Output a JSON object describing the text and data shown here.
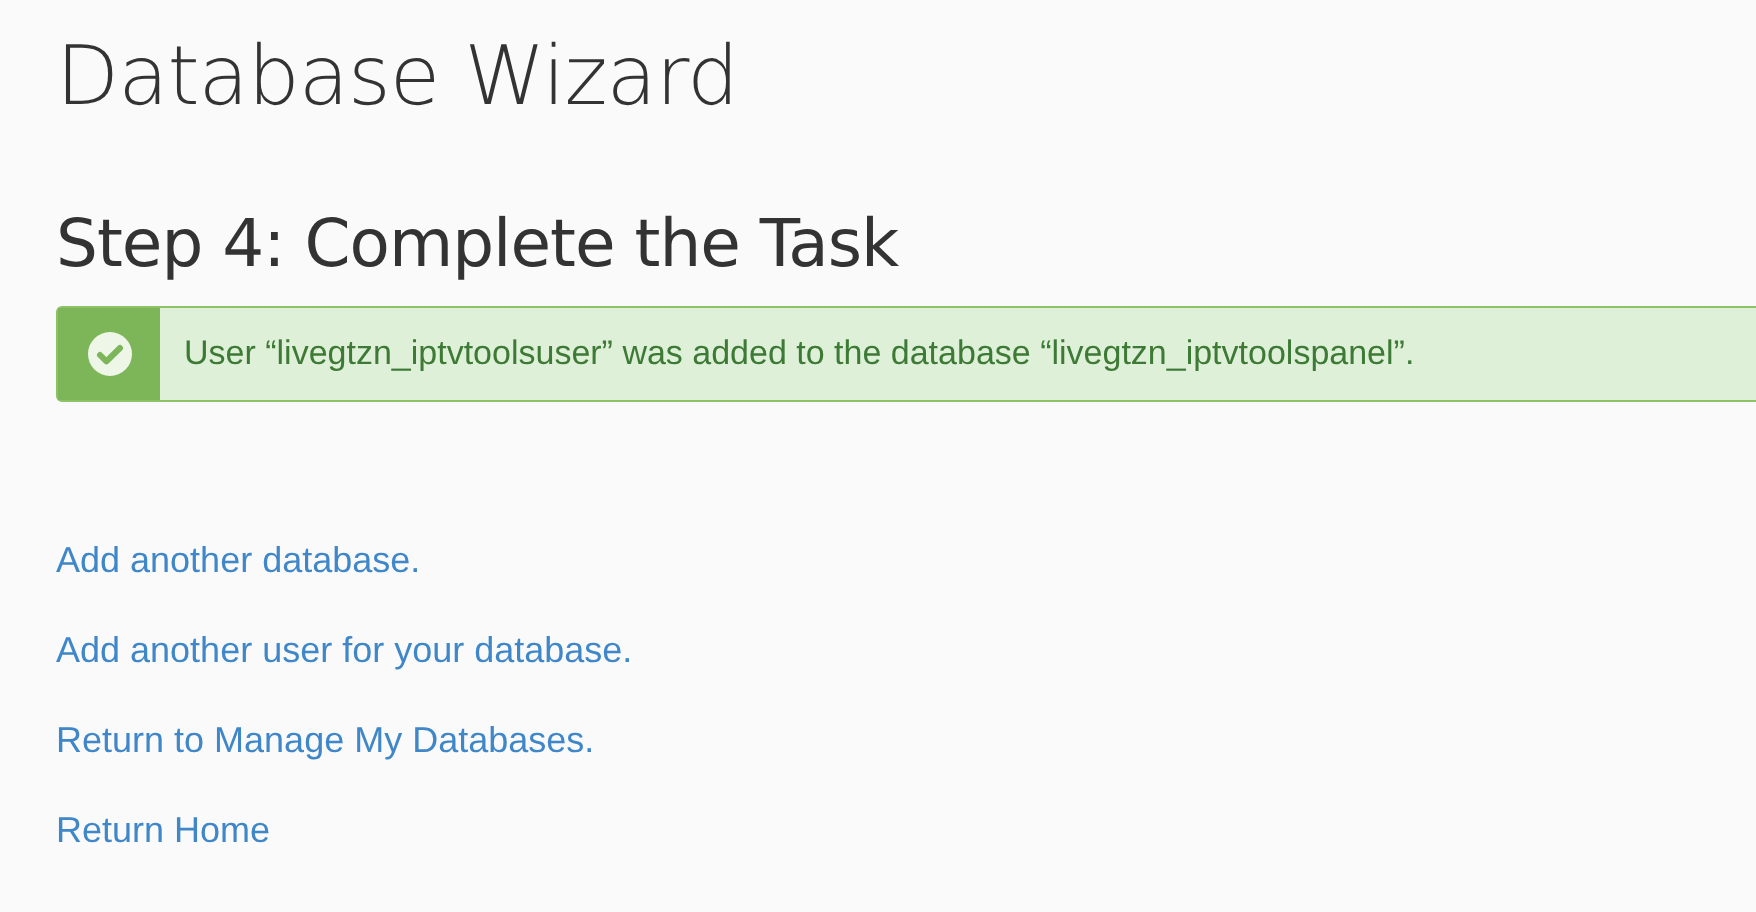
{
  "page": {
    "title": "Database Wizard"
  },
  "step": {
    "heading": "Step 4: Complete the Task"
  },
  "alert": {
    "kind": "success",
    "message": "User “livegtzn_iptvtoolsuser” was added to the database “livegtzn_iptvtoolspanel”."
  },
  "links": [
    {
      "label": "Add another database."
    },
    {
      "label": "Add another user for your database."
    },
    {
      "label": "Return to Manage My Databases."
    },
    {
      "label": "Return Home"
    }
  ]
}
